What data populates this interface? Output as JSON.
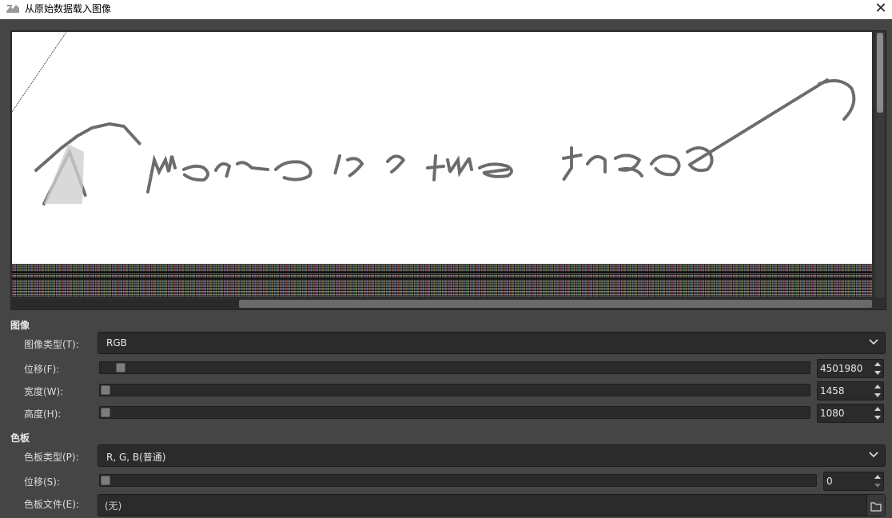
{
  "window": {
    "title": "从原始数据载入图像",
    "close_label": "✕"
  },
  "image_section": {
    "heading": "图像",
    "type_label": "图像类型(T):",
    "type_value": "RGB",
    "offset_label": "位移(F):",
    "offset_value": "4501980",
    "width_label": "宽度(W):",
    "width_value": "1458",
    "height_label": "高度(H):",
    "height_value": "1080"
  },
  "palette_section": {
    "heading": "色板",
    "type_label": "色板类型(P):",
    "type_value": "R, G, B(普通)",
    "offset_label": "位移(S):",
    "offset_value": "0",
    "file_label": "色板文件(E):",
    "file_value": "(无)"
  },
  "colors": {
    "background": "#454545",
    "field": "#2b2b2b",
    "preview": "#ffffff"
  }
}
